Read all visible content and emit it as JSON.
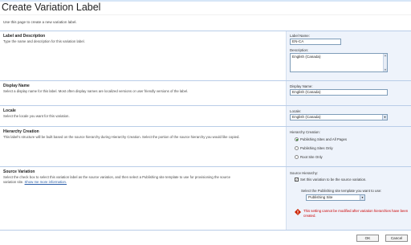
{
  "page": {
    "title": "Create Variation Label",
    "subtitle": "Use this page to create a new variation label."
  },
  "sections": {
    "label_desc": {
      "title": "Label and Description",
      "description": "Type the name and description for this variation label.",
      "label_name": {
        "label": "Label Name:",
        "value": "EN-CA"
      },
      "description_field": {
        "label": "Description:",
        "value": "English (Canada)"
      }
    },
    "display_name": {
      "title": "Display Name",
      "description": "Select a display name for this label.  Most often display names are localized versions or user friendly versions of the label.",
      "field": {
        "label": "Display Name:",
        "value": "English (Canada)"
      }
    },
    "locale": {
      "title": "Locale",
      "description": "Select the locale you want for this variation.",
      "field": {
        "label": "Locale:",
        "value": "English (Canada)"
      }
    },
    "hierarchy": {
      "title": "Hierarchy Creation",
      "description": "This label's structure will be built based on the source hierarchy during Hierarchy Creation.  Select the portion of the source hierarchy you would like copied.",
      "field_label": "Hierarchy Creation:",
      "options": [
        {
          "label": "Publishing Sites and All Pages",
          "selected": true
        },
        {
          "label": "Publishing Sites Only",
          "selected": false
        },
        {
          "label": "Root Site Only",
          "selected": false
        }
      ]
    },
    "source": {
      "title": "Source Variation",
      "description": "Select the check box to select this variation label as the source variation, and then select a Publishing site template to use for provisioning the source variation site.",
      "link": "Show me more information.",
      "field_label": "Source Hierarchy:",
      "checkbox_label": "Set this variation to be the source variation.",
      "checkbox_checked": true,
      "template_label": "Select the Publishing site template you want to use:",
      "template_value": "Publishing Site",
      "warning": "This setting cannot be modified after variation hierarchies have been created."
    }
  },
  "buttons": {
    "ok": "OK",
    "cancel": "Cancel"
  },
  "colors": {
    "accent": "#b9cde8",
    "panel": "#eef3fb",
    "warning": "#cc0000"
  }
}
